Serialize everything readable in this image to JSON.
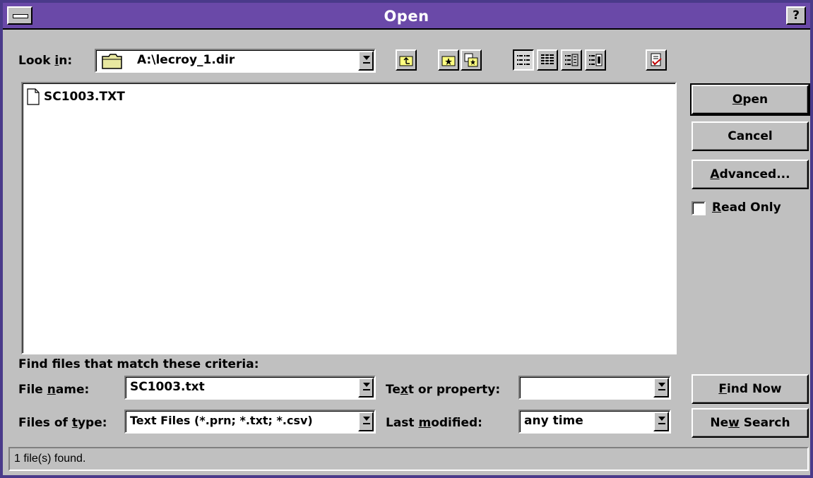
{
  "window": {
    "title": "Open",
    "help_label": "?"
  },
  "look_in": {
    "label_pre": "Look ",
    "label_u": "i",
    "label_post": "n:",
    "value": "A:\\lecroy_1.dir"
  },
  "toolbar": [
    {
      "name": "up-one-level-icon"
    },
    {
      "name": "look-in-favorites-icon"
    },
    {
      "name": "add-to-favorites-icon"
    },
    {
      "name": "list-view-icon"
    },
    {
      "name": "details-view-icon"
    },
    {
      "name": "properties-view-icon"
    },
    {
      "name": "preview-view-icon"
    },
    {
      "name": "commands-settings-icon"
    }
  ],
  "files": [
    {
      "name": "SC1003.TXT"
    }
  ],
  "buttons": {
    "open": {
      "u": "O",
      "rest": "pen"
    },
    "cancel": "Cancel",
    "advanced": {
      "u": "A",
      "rest": "dvanced..."
    },
    "find_now": {
      "u": "F",
      "rest": "ind Now"
    },
    "new_search": {
      "pre": "Ne",
      "u": "w",
      "rest": " Search"
    }
  },
  "read_only": {
    "u": "R",
    "rest": "ead Only",
    "checked": false
  },
  "criteria": {
    "heading": "Find files that match these criteria:",
    "file_name": {
      "label_pre": "File ",
      "label_u": "n",
      "label_post": "ame:",
      "value": "SC1003.txt"
    },
    "files_of_type": {
      "label_pre": "Files of ",
      "label_u": "t",
      "label_post": "ype:",
      "value": "Text Files (*.prn; *.txt; *.csv)"
    },
    "text_or_property": {
      "label_pre": "Te",
      "label_u": "x",
      "label_post": "t or property:",
      "value": ""
    },
    "last_modified": {
      "label_pre": "Last ",
      "label_u": "m",
      "label_post": "odified:",
      "value": "any time"
    }
  },
  "status": "1 file(s) found.",
  "colors": {
    "titlebar": "#6a49a8",
    "face": "#c0c0c0"
  }
}
